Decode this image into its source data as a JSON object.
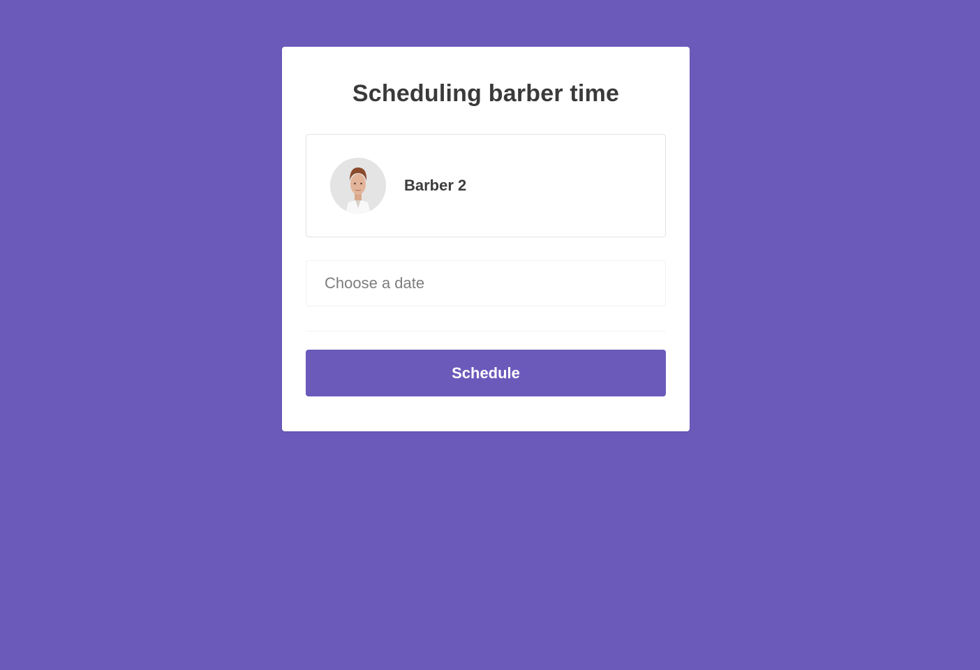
{
  "page": {
    "title": "Scheduling barber time"
  },
  "barber": {
    "name": "Barber 2",
    "avatar": "barber-portrait"
  },
  "date_field": {
    "placeholder": "Choose a date",
    "value": ""
  },
  "actions": {
    "schedule_label": "Schedule"
  },
  "colors": {
    "background": "#6c5abb",
    "accent": "#6c5abb",
    "card": "#ffffff",
    "text": "#3a3a3a"
  }
}
